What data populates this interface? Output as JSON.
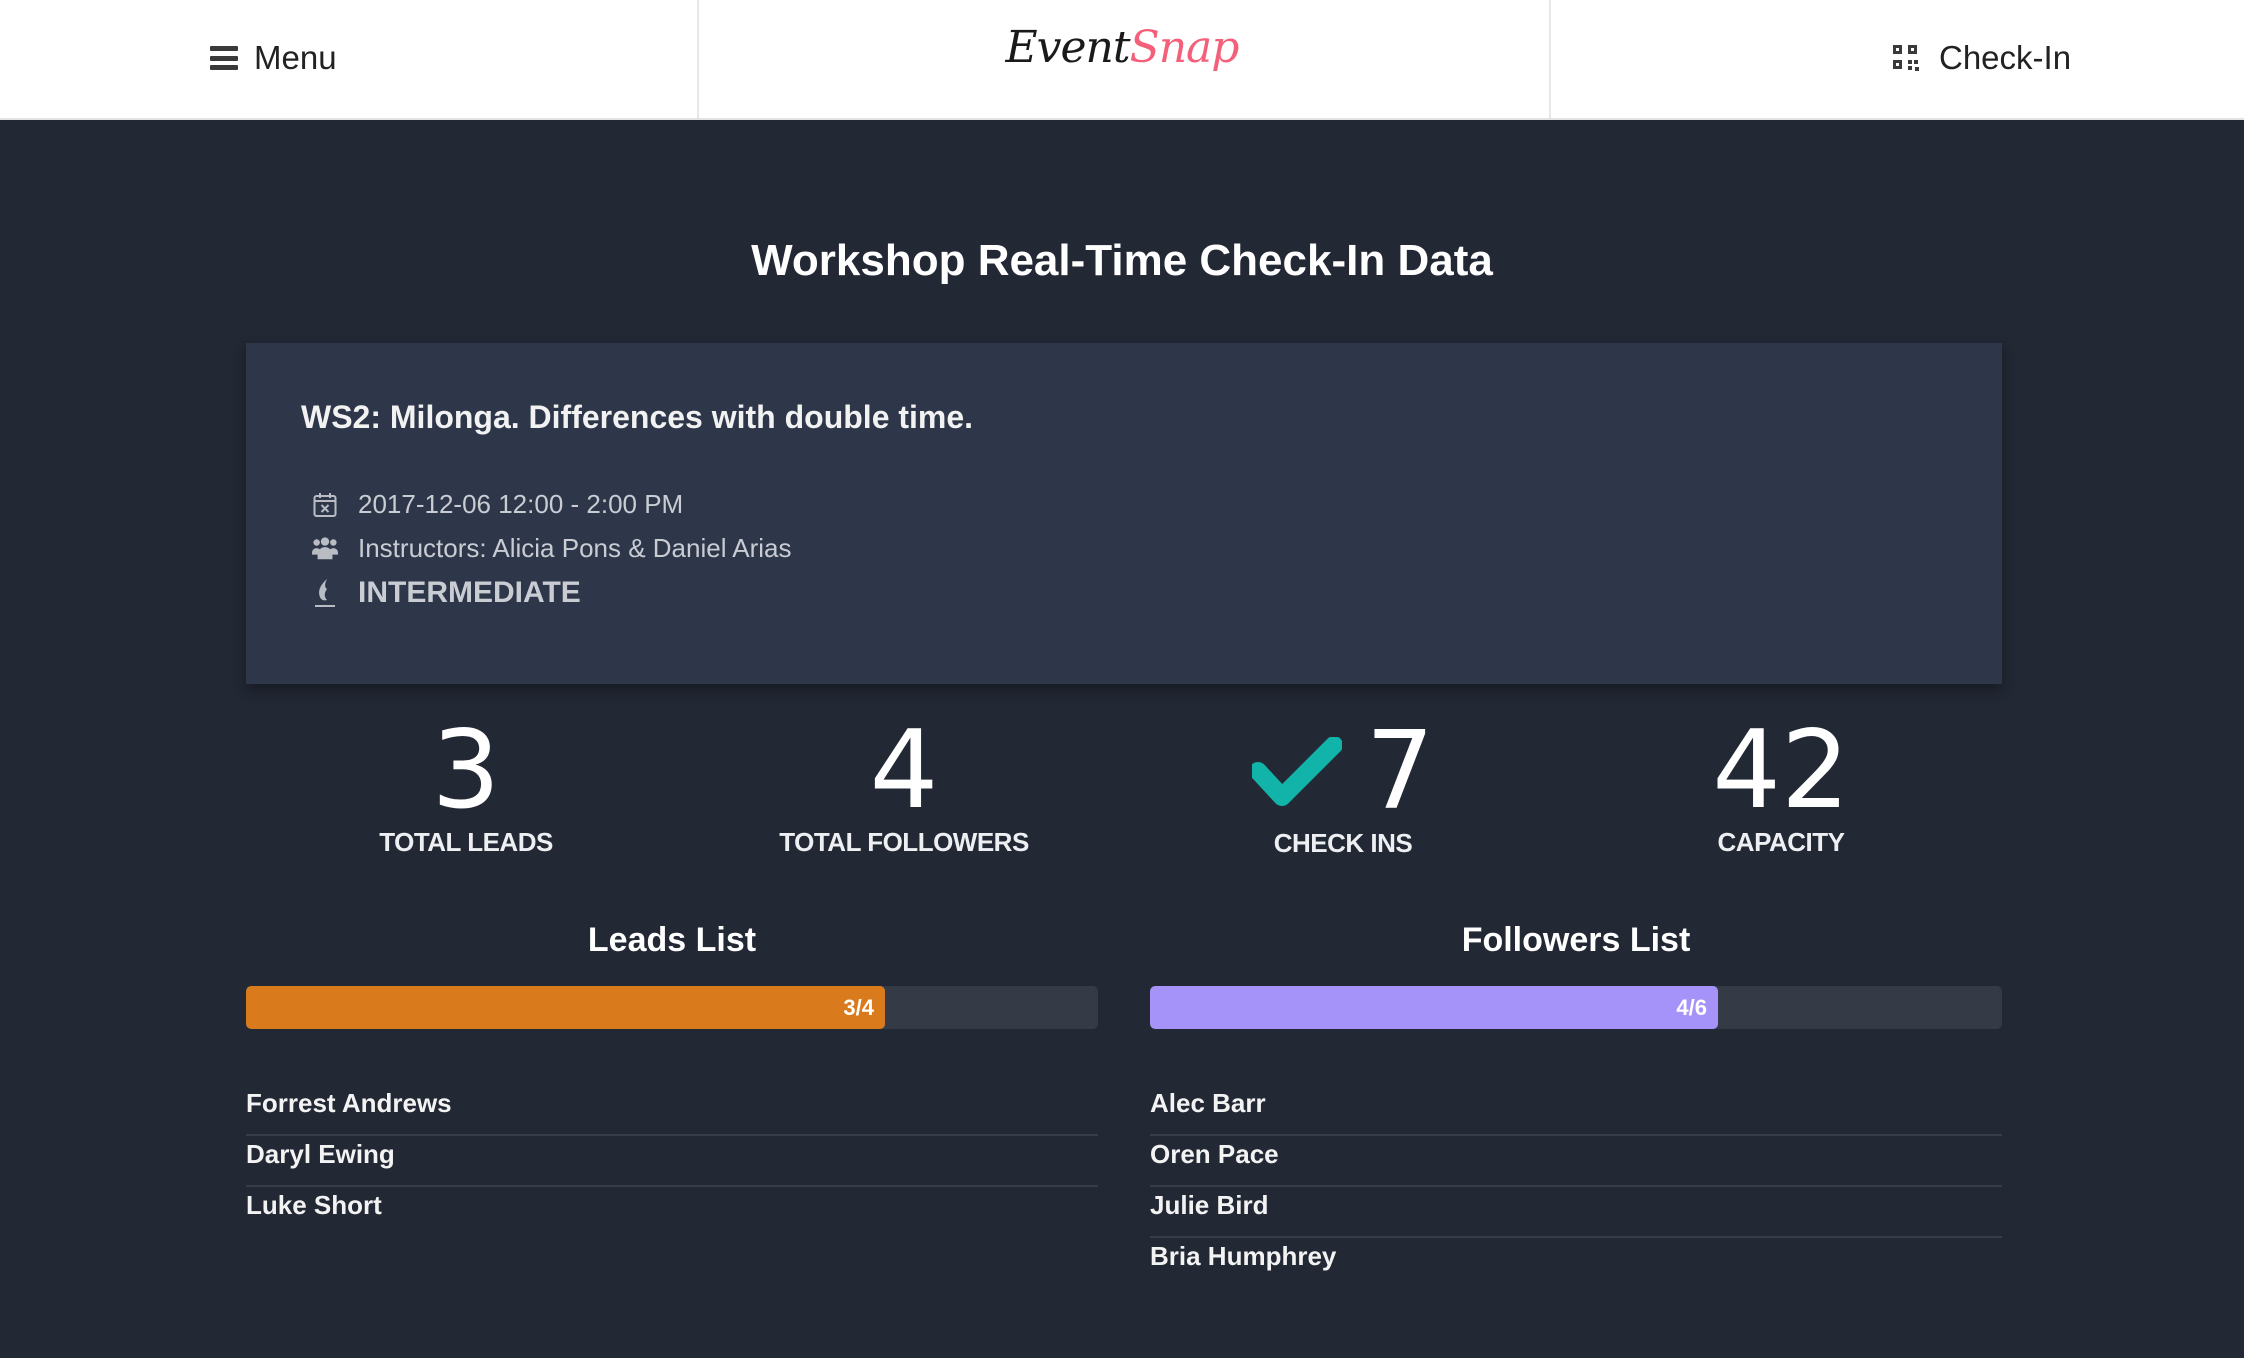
{
  "header": {
    "menu_label": "Menu",
    "logo_part1": "Event",
    "logo_part2": "Snap",
    "checkin_label": "Check-In"
  },
  "page_title": "Workshop Real-Time Check-In Data",
  "workshop": {
    "title": "WS2: Milonga. Differences with double time.",
    "datetime": "2017-12-06 12:00 - 2:00 PM",
    "instructors": "Instructors: Alicia Pons & Daniel Arias",
    "level": "INTERMEDIATE"
  },
  "stats": [
    {
      "value": "3",
      "label": "TOTAL LEADS"
    },
    {
      "value": "4",
      "label": "TOTAL FOLLOWERS"
    },
    {
      "value": "7",
      "label": "CHECK INS"
    },
    {
      "value": "42",
      "label": "CAPACITY"
    }
  ],
  "colors": {
    "accent_check": "#12b3a8",
    "leads_bar": "#d97b1c",
    "followers_bar": "#a693fa",
    "logo_accent": "#f4607a"
  },
  "leads": {
    "title": "Leads List",
    "progress_label": "3/4",
    "checked_in": 3,
    "total": 4,
    "names": [
      "Forrest Andrews",
      "Daryl Ewing",
      "Luke Short"
    ]
  },
  "followers": {
    "title": "Followers List",
    "progress_label": "4/6",
    "checked_in": 4,
    "total": 6,
    "names": [
      "Alec Barr",
      "Oren Pace",
      "Julie Bird",
      "Bria Humphrey"
    ]
  }
}
